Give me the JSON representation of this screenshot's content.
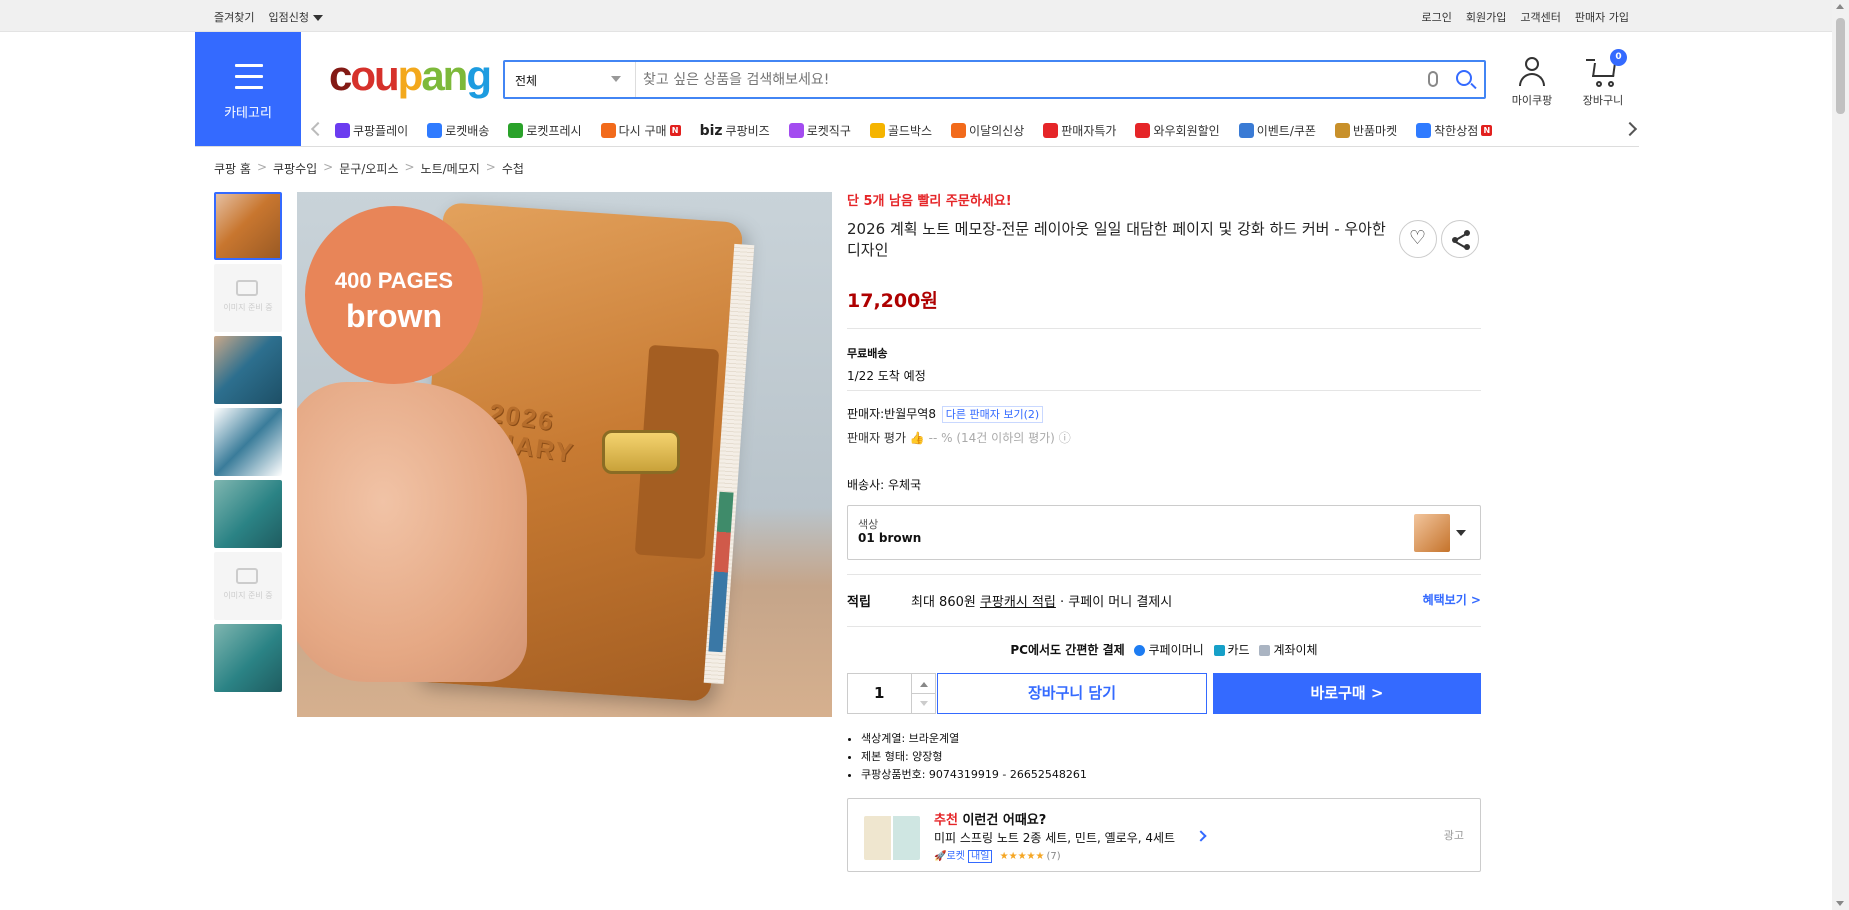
{
  "topbar": {
    "left": [
      "즐겨찾기",
      "입점신청"
    ],
    "right": [
      "로그인",
      "회원가입",
      "고객센터",
      "판매자 가입"
    ]
  },
  "header": {
    "category_label": "카테고리",
    "logo": [
      "c",
      "ou",
      "p",
      "an",
      "g"
    ],
    "search_select": "전체",
    "search_placeholder": "찾고 싶은 상품을 검색해보세요!",
    "mycoupang": "마이쿠팡",
    "cart": "장바구니",
    "cart_count": "0"
  },
  "menu": [
    {
      "label": "쿠팡플레이",
      "color": "#6b3cf0"
    },
    {
      "label": "로켓배송",
      "color": "#2f7bff"
    },
    {
      "label": "로켓프레시",
      "color": "#2aa22a"
    },
    {
      "label": "다시 구매",
      "color": "#f26a1b",
      "badge": "N"
    },
    {
      "label": "쿠팡비즈",
      "prefix": "biz",
      "color": "#222"
    },
    {
      "label": "로켓직구",
      "color": "#a34cf0"
    },
    {
      "label": "골드박스",
      "color": "#f5b400"
    },
    {
      "label": "이달의신상",
      "color": "#f26a1b"
    },
    {
      "label": "판매자특가",
      "color": "#e52528"
    },
    {
      "label": "와우회원할인",
      "color": "#e52528"
    },
    {
      "label": "이벤트/쿠폰",
      "color": "#3a7bd5"
    },
    {
      "label": "반품마켓",
      "color": "#c8902a"
    },
    {
      "label": "착한상점",
      "color": "#2f7bff",
      "badge": "N"
    }
  ],
  "breadcrumb": [
    "쿠팡 홈",
    "쿠팡수입",
    "문구/오피스",
    "노트/메모지",
    "수첩"
  ],
  "gallery": {
    "placeholder_text": "이미지 준비 중",
    "badge_line1": "400 PAGES",
    "badge_line2": "brown",
    "cover_text1": "2026",
    "cover_text2": "DIARY"
  },
  "product": {
    "urgent": "단 5개 남음 빨리 주문하세요!",
    "title": "2026 계획 노트 메모장-전문 레이아웃 일일 대담한 페이지 및 강화 하드 커버 - 우아한 디자인",
    "price": "17,200원",
    "shipping_free": "무료배송",
    "eta": "1/22 도착 예정",
    "seller_label": "판매자:",
    "seller_name": "반월무역8",
    "other_sellers": "다른 판매자 보기(2)",
    "seller_rating_label": "판매자 평가",
    "seller_rating_value": "-- %",
    "seller_rating_note": "(14건 이하의 평가)",
    "carrier_label": "배송사:",
    "carrier": "우체국",
    "option_label": "색상",
    "option_value": "01 brown",
    "reward_key": "적립",
    "reward_value_prefix": "최대 860원",
    "reward_link": "쿠팡캐시 적립",
    "reward_suffix": "· 쿠페이 머니 결제시",
    "reward_more": "혜택보기 >",
    "pay_title": "PC에서도 간편한 결제",
    "pay_methods": [
      "쿠페이머니",
      "카드",
      "계좌이체"
    ],
    "qty": "1",
    "add_cart": "장바구니 담기",
    "buy_now": "바로구매 >",
    "specs": [
      "색상계열: 브라운계열",
      "제본 형태: 양장형",
      "쿠팡상품번호: 9074319919 - 26652548261"
    ]
  },
  "recommend": {
    "head_red": "추천",
    "head_rest": " 이런건 어때요?",
    "title": "미피 스프링 노트 2종 세트, 민트, 옐로우, 4세트",
    "rocket": "로켓",
    "tomorrow": "내일",
    "stars": "★★★★★",
    "count": "(7)",
    "ad": "광고"
  }
}
